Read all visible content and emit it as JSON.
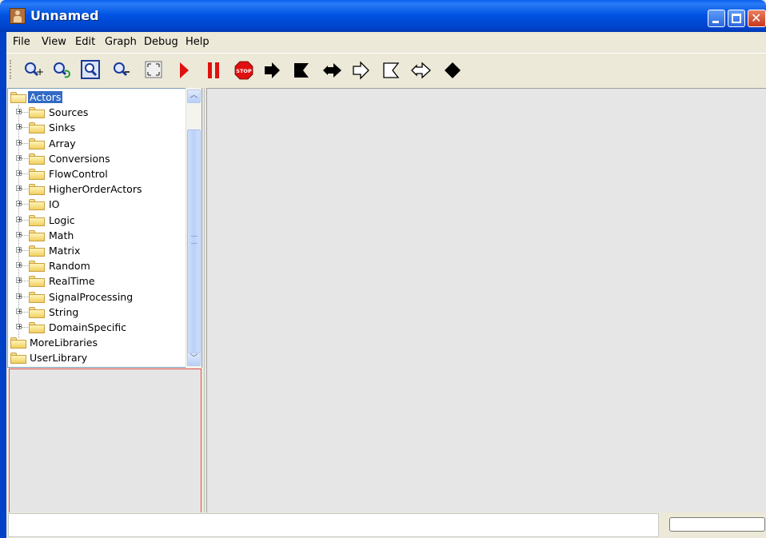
{
  "window": {
    "title": "Unnamed",
    "controls": [
      "minimize-icon",
      "maximize-icon",
      "close-icon"
    ]
  },
  "menu": [
    "File",
    "View",
    "Edit",
    "Graph",
    "Debug",
    "Help"
  ],
  "toolbar": {
    "buttons": [
      {
        "name": "zoom-in-icon"
      },
      {
        "name": "zoom-reset-icon"
      },
      {
        "name": "zoom-fit-icon"
      },
      {
        "name": "zoom-out-icon"
      },
      {
        "name": "full-screen-icon"
      },
      {
        "name": "run-icon",
        "color": "#e01010"
      },
      {
        "name": "pause-icon",
        "color": "#e01010"
      },
      {
        "name": "stop-icon",
        "color": "#e01010",
        "text": "STOP"
      },
      {
        "name": "step-forward-icon"
      },
      {
        "name": "flag-icon"
      },
      {
        "name": "double-arrow-icon"
      },
      {
        "name": "outline-step-icon"
      },
      {
        "name": "outline-flag-icon"
      },
      {
        "name": "outline-double-arrow-icon"
      },
      {
        "name": "diamond-icon"
      }
    ]
  },
  "tree": {
    "root": "Actors",
    "children": [
      "Sources",
      "Sinks",
      "Array",
      "Conversions",
      "FlowControl",
      "HigherOrderActors",
      "IO",
      "Logic",
      "Math",
      "Matrix",
      "Random",
      "RealTime",
      "SignalProcessing",
      "String",
      "DomainSpecific"
    ],
    "siblings": [
      "MoreLibraries",
      "UserLibrary"
    ]
  },
  "statusbar": {
    "message": ""
  },
  "colors": {
    "titlebar": "#0054e3",
    "selection": "#316ac5",
    "canvas": "#e6e6e6",
    "accent_red": "#e01010"
  }
}
